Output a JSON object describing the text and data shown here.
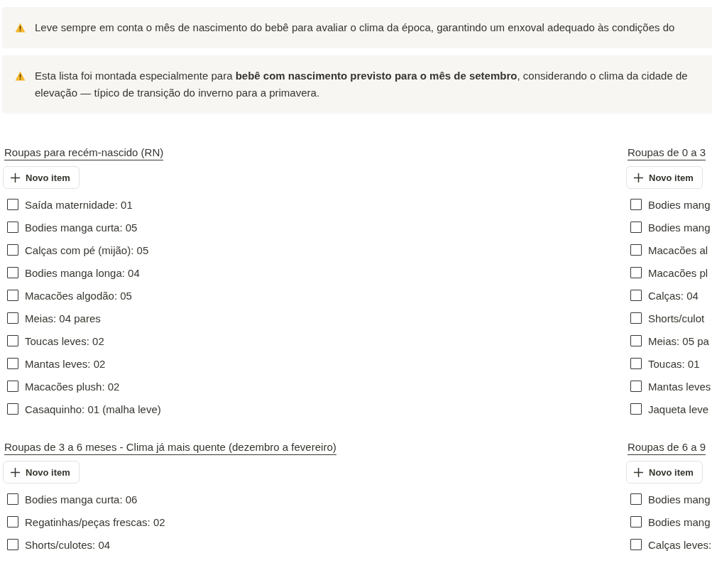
{
  "callouts": [
    {
      "kind": "warning",
      "lines": [
        "Leve sempre em conta o mês de nascimento do bebê para avaliar o clima da época, garantindo um enxoval adequado às condições do"
      ]
    },
    {
      "kind": "warning",
      "lines": [
        "Esta lista foi montada especialmente para **bebê com nascimento previsto para o mês de setembro**, considerando o clima da cidade de",
        "elevação — típico de transição do inverno para a primavera."
      ]
    }
  ],
  "sections": [
    {
      "title": "Roupas para recém-nascido (RN)",
      "button": "Novo item",
      "items": [
        {
          "label": "Saída maternidade: 01",
          "checked": false
        },
        {
          "label": "Bodies manga curta: 05",
          "checked": false
        },
        {
          "label": "Calças com pé (mijão): 05",
          "checked": false
        },
        {
          "label": "Bodies manga longa: 04",
          "checked": false
        },
        {
          "label": "Macacões algodão: 05",
          "checked": false
        },
        {
          "label": "Meias: 04 pares",
          "checked": false
        },
        {
          "label": "Toucas leves: 02",
          "checked": false
        },
        {
          "label": "Mantas leves: 02",
          "checked": false
        },
        {
          "label": "Macacões plush: 02",
          "checked": false
        },
        {
          "label": "Casaquinho: 01 (malha leve)",
          "checked": false
        }
      ]
    },
    {
      "title": "Roupas de 0 a 3",
      "button": "Novo item",
      "items": [
        {
          "label": "Bodies mang",
          "checked": false
        },
        {
          "label": "Bodies mang",
          "checked": false
        },
        {
          "label": "Macacões al",
          "checked": false
        },
        {
          "label": "Macacões pl",
          "checked": false
        },
        {
          "label": "Calças: 04",
          "checked": false
        },
        {
          "label": "Shorts/culot",
          "checked": false
        },
        {
          "label": "Meias: 05 pa",
          "checked": false
        },
        {
          "label": "Toucas: 01",
          "checked": false
        },
        {
          "label": "Mantas leves",
          "checked": false
        },
        {
          "label": "Jaqueta leve",
          "checked": false
        }
      ]
    },
    {
      "title": "Roupas de 3 a 6 meses - Clima já mais quente (dezembro a fevereiro)",
      "button": "Novo item",
      "items": [
        {
          "label": "Bodies manga curta: 06",
          "checked": false
        },
        {
          "label": "Regatinhas/peças frescas: 02",
          "checked": false
        },
        {
          "label": "Shorts/culotes: 04",
          "checked": false
        }
      ]
    },
    {
      "title": "Roupas de 6 a 9",
      "button": "Novo item",
      "items": [
        {
          "label": "Bodies mang",
          "checked": false
        },
        {
          "label": "Bodies mang",
          "checked": false
        },
        {
          "label": "Calças leves:",
          "checked": false
        }
      ]
    }
  ]
}
